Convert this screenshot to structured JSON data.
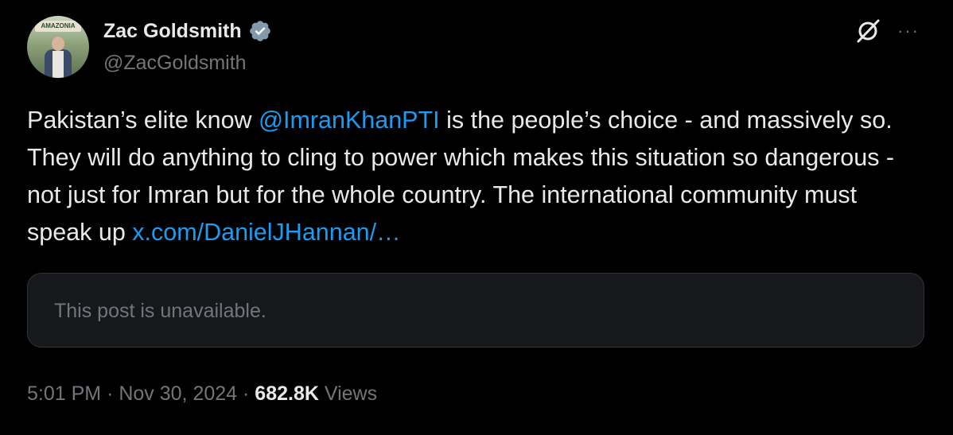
{
  "author": {
    "name": "Zac Goldsmith",
    "handle": "@ZacGoldsmith",
    "avatar_sign_text": "AMAZONIA",
    "verified_icon": "verified-badge-icon",
    "verified_color": "#829aab"
  },
  "header_actions": {
    "grok_icon": "grok-icon",
    "more_icon": "more-options-icon",
    "more_label": "···"
  },
  "tweet": {
    "text_part1": "Pakistan’s elite know ",
    "mention": "@ImranKhanPTI",
    "text_part2": " is the people’s choice - and massively so. They will do anything to cling to power which makes this situation so dangerous - not just for Imran but for the whole country. The international community must speak up ",
    "link": "x.com/DanielJHannan/…"
  },
  "quote": {
    "text": "This post is unavailable."
  },
  "meta": {
    "time": "5:01 PM",
    "separator": "·",
    "date": "Nov 30, 2024",
    "views_count": "682.8K",
    "views_label": "Views"
  },
  "colors": {
    "background": "#000000",
    "text": "#e7e9ea",
    "secondary": "#71767b",
    "link": "#1d9bf0",
    "card_bg": "#16181c",
    "card_border": "#2f3336"
  }
}
